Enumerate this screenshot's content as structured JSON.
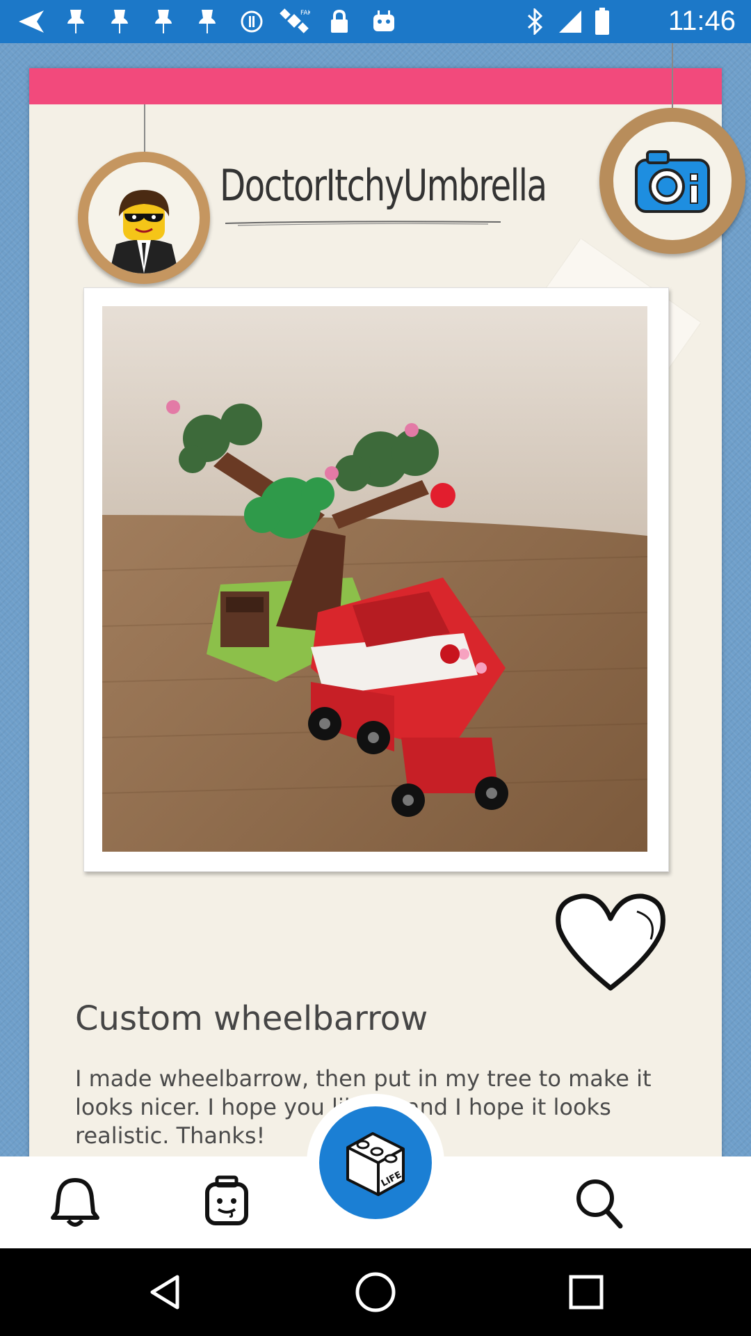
{
  "status_bar": {
    "time": "11:46",
    "icons": [
      "back-arrow-icon",
      "pin-icon",
      "pin-icon",
      "pin-icon",
      "alert-icon",
      "satellite-icon",
      "lock-icon",
      "android-icon",
      "bluetooth-icon",
      "signal-icon",
      "battery-icon"
    ]
  },
  "profile": {
    "username": "DoctorItchyUmbrella",
    "avatar_icon": "minifigure-avatar-icon"
  },
  "camera": {
    "icon": "camera-icon"
  },
  "post": {
    "title": "Custom wheelbarrow",
    "description": "I made wheelbarrow, then put in my tree to make it looks nicer. I hope you like it, and I hope it looks realistic. Thanks!",
    "like_icon": "heart-icon"
  },
  "bottom_nav": {
    "items": [
      {
        "icon": "bell-icon"
      },
      {
        "icon": "minifigure-head-icon"
      },
      {
        "icon": "lego-life-icon",
        "label": "LIFE"
      },
      {
        "icon": "search-icon"
      }
    ]
  },
  "system_nav": {
    "items": [
      {
        "icon": "back-triangle-icon"
      },
      {
        "icon": "home-circle-icon"
      },
      {
        "icon": "recents-square-icon"
      }
    ]
  },
  "colors": {
    "status_bar": "#1c78c8",
    "background": "#6f9fca",
    "card": "#f4f0e6",
    "accent_pink": "#f24a7c",
    "life_button": "#1b7fd4"
  }
}
